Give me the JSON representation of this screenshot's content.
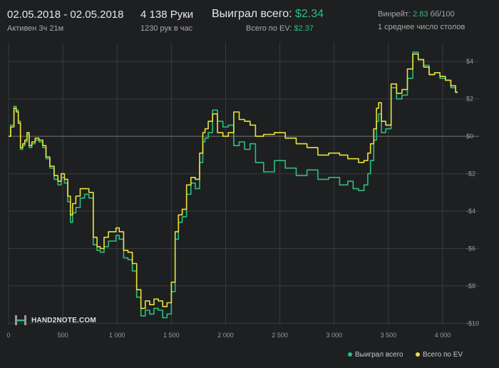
{
  "header": {
    "dates": "02.05.2018 - 02.05.2018",
    "active": "Активен 3ч 21м",
    "hands": "4 138 Руки",
    "hands_rate": "1230 рук в час",
    "won_label": "Выиграл всего:",
    "won_value": "$2.34",
    "ev_label": "Всего по EV:",
    "ev_value": "$2.37",
    "winrate_label": "Винрейт:",
    "winrate_value": "2.83",
    "winrate_unit": "бб/100",
    "tables": "1 среднее число столов"
  },
  "logo": {
    "text": "HAND2NOTE.COM",
    "icon": "hand2note-logo-icon"
  },
  "colors": {
    "won": "#2bbf7f",
    "ev": "#e8e23a",
    "background": "#1e1f21",
    "grid": "#3a3b3e",
    "zero": "#777777"
  },
  "legend": [
    {
      "label": "Выиграл всего",
      "color": "#2bbf7f"
    },
    {
      "label": "Всего по EV",
      "color": "#e8e23a"
    }
  ],
  "chart_data": {
    "type": "line",
    "x_ticks": [
      0,
      500,
      1000,
      1500,
      2000,
      2500,
      3000,
      3500,
      4000
    ],
    "x_tick_labels": [
      "0",
      "500",
      "1 000",
      "1 500",
      "2 000",
      "2 500",
      "3 000",
      "3 500",
      "4 000"
    ],
    "y_ticks": [
      4,
      2,
      0,
      -2,
      -4,
      -6,
      -8,
      -10
    ],
    "y_tick_labels": [
      "$4",
      "$2",
      "$0",
      "-$2",
      "-$4",
      "-$6",
      "-$8",
      "-$10"
    ],
    "xlim": [
      0,
      4138
    ],
    "ylim": [
      -10.1,
      5.0
    ],
    "grid": true,
    "legend_position": "bottom-right",
    "series": [
      {
        "name": "Выиграл всего",
        "color": "#2bbf7f",
        "x": [
          0,
          40,
          60,
          80,
          100,
          120,
          140,
          160,
          180,
          200,
          230,
          260,
          300,
          330,
          360,
          400,
          440,
          470,
          500,
          530,
          560,
          580,
          600,
          640,
          680,
          720,
          760,
          800,
          830,
          860,
          900,
          940,
          980,
          1000,
          1040,
          1080,
          1120,
          1160,
          1200,
          1240,
          1280,
          1320,
          1360,
          1400,
          1440,
          1480,
          1520,
          1550,
          1580,
          1620,
          1660,
          1700,
          1740,
          1780,
          1800,
          1820,
          1860,
          1900,
          1950,
          2000,
          2050,
          2100,
          2150,
          2200,
          2250,
          2300,
          2400,
          2500,
          2600,
          2700,
          2800,
          2900,
          3000,
          3100,
          3150,
          3200,
          3250,
          3300,
          3320,
          3350,
          3380,
          3400,
          3420,
          3450,
          3500,
          3550,
          3600,
          3650,
          3700,
          3750,
          3800,
          3850,
          3900,
          3950,
          4000,
          4050,
          4100,
          4138
        ],
        "y": [
          0,
          0.6,
          1.6,
          1.4,
          0.8,
          -0.7,
          -0.5,
          -0.3,
          0.1,
          -0.6,
          -0.4,
          -0.2,
          -0.3,
          -0.6,
          -1.2,
          -1.7,
          -2.3,
          -2.6,
          -2.2,
          -2.5,
          -3.5,
          -4.6,
          -4.1,
          -3.8,
          -3.3,
          -3.1,
          -3.3,
          -5.8,
          -6.1,
          -6.2,
          -5.9,
          -5.6,
          -5.6,
          -5.3,
          -5.5,
          -6.5,
          -6.6,
          -7.2,
          -8.6,
          -9.6,
          -9.3,
          -9.5,
          -9.2,
          -9.3,
          -9.7,
          -9.5,
          -8.3,
          -5.5,
          -4.6,
          -4.3,
          -3.1,
          -2.5,
          -2.8,
          -1.4,
          -0.3,
          -0.1,
          0.2,
          1.4,
          0.8,
          0.5,
          0.6,
          -0.5,
          -0.3,
          -0.7,
          -0.4,
          -1.4,
          -1.9,
          -1.3,
          -1.7,
          -2.1,
          -1.8,
          -2.3,
          -2.2,
          -2.6,
          -2.4,
          -2.8,
          -2.9,
          -2.6,
          -2.0,
          -1.3,
          -0.2,
          0.8,
          1.2,
          0.2,
          0.4,
          2.6,
          2.0,
          2.2,
          3.1,
          4.5,
          4.1,
          3.8,
          3.3,
          3.4,
          3.1,
          3.0,
          2.6,
          2.34
        ]
      },
      {
        "name": "Всего по EV",
        "color": "#e8e23a",
        "x": [
          0,
          40,
          60,
          80,
          100,
          120,
          140,
          160,
          180,
          200,
          230,
          260,
          300,
          330,
          360,
          400,
          440,
          470,
          500,
          530,
          560,
          580,
          600,
          640,
          680,
          720,
          760,
          800,
          830,
          860,
          900,
          940,
          980,
          1000,
          1040,
          1080,
          1120,
          1160,
          1200,
          1240,
          1280,
          1320,
          1360,
          1400,
          1440,
          1480,
          1520,
          1550,
          1580,
          1620,
          1660,
          1700,
          1740,
          1780,
          1800,
          1820,
          1860,
          1900,
          1950,
          2000,
          2050,
          2100,
          2150,
          2200,
          2250,
          2300,
          2400,
          2500,
          2600,
          2700,
          2800,
          2900,
          3000,
          3100,
          3150,
          3200,
          3250,
          3300,
          3320,
          3350,
          3380,
          3400,
          3420,
          3450,
          3500,
          3550,
          3600,
          3650,
          3700,
          3750,
          3800,
          3850,
          3900,
          3950,
          4000,
          4050,
          4100,
          4138
        ],
        "y": [
          0,
          0.5,
          1.5,
          1.3,
          0.7,
          -0.6,
          -0.4,
          -0.2,
          0.2,
          -0.5,
          -0.3,
          -0.1,
          -0.2,
          -0.5,
          -1.1,
          -1.6,
          -2.1,
          -2.4,
          -2.0,
          -2.3,
          -3.2,
          -4.2,
          -3.6,
          -3.2,
          -2.8,
          -2.8,
          -3.0,
          -5.4,
          -5.9,
          -6.0,
          -5.4,
          -5.1,
          -5.1,
          -4.9,
          -5.1,
          -6.1,
          -6.2,
          -6.8,
          -8.2,
          -9.2,
          -8.8,
          -9.0,
          -8.7,
          -8.8,
          -9.1,
          -8.9,
          -7.8,
          -5.1,
          -4.2,
          -3.9,
          -2.6,
          -2.2,
          -2.3,
          -0.9,
          0.2,
          0.4,
          0.8,
          1.2,
          0.2,
          0.0,
          0.2,
          1.3,
          0.9,
          0.8,
          0.6,
          0.0,
          0.1,
          0.2,
          -0.1,
          -0.4,
          -0.6,
          -1.0,
          -0.9,
          -1.0,
          -1.2,
          -1.2,
          -1.4,
          -1.3,
          -0.9,
          -0.4,
          0.4,
          1.5,
          1.8,
          0.8,
          0.6,
          2.8,
          2.3,
          2.5,
          3.6,
          4.4,
          4.1,
          3.7,
          3.3,
          3.4,
          3.2,
          3.0,
          2.7,
          2.37
        ]
      }
    ]
  }
}
